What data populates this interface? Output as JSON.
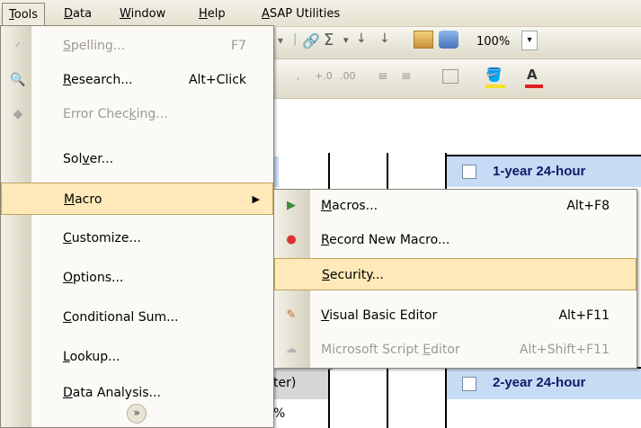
{
  "menubar": {
    "items": [
      {
        "label": "Tools",
        "mnemonic": "T",
        "rest": "ools"
      },
      {
        "label": "Data",
        "mnemonic": "D",
        "rest": "ata"
      },
      {
        "label": "Window",
        "mnemonic": "W",
        "rest": "indow"
      },
      {
        "label": "Help",
        "mnemonic": "H",
        "rest": "elp"
      },
      {
        "label": "ASAP Utilities",
        "mnemonic": "A",
        "rest": "SAP Utilities"
      }
    ]
  },
  "toolbar": {
    "zoom": "100%"
  },
  "tools_menu": {
    "items": [
      {
        "pre": "",
        "u": "S",
        "post": "pelling...",
        "shortcut": "F7",
        "icon": "spelling-icon",
        "disabled": true
      },
      {
        "pre": "",
        "u": "R",
        "post": "esearch...",
        "shortcut": "Alt+Click",
        "icon": "research-icon",
        "disabled": false
      },
      {
        "pre": "Error Chec",
        "u": "k",
        "post": "ing...",
        "shortcut": "",
        "icon": "error-checking-icon",
        "disabled": true
      },
      {
        "pre": "Sol",
        "u": "v",
        "post": "er...",
        "shortcut": "",
        "icon": "",
        "disabled": false
      },
      {
        "pre": "",
        "u": "M",
        "post": "acro",
        "shortcut": "",
        "icon": "",
        "disabled": false,
        "highlighted": true
      },
      {
        "pre": "",
        "u": "C",
        "post": "ustomize...",
        "shortcut": "",
        "icon": "",
        "disabled": false
      },
      {
        "pre": "",
        "u": "O",
        "post": "ptions...",
        "shortcut": "",
        "icon": "",
        "disabled": false
      },
      {
        "pre": "",
        "u": "C",
        "post": "onditional Sum...",
        "shortcut": "",
        "icon": "",
        "disabled": false
      },
      {
        "pre": "",
        "u": "L",
        "post": "ookup...",
        "shortcut": "",
        "icon": "",
        "disabled": false
      },
      {
        "pre": "",
        "u": "D",
        "post": "ata Analysis...",
        "shortcut": "",
        "icon": "",
        "disabled": false
      }
    ]
  },
  "macro_submenu": {
    "items": [
      {
        "pre": "",
        "u": "M",
        "post": "acros...",
        "shortcut": "Alt+F8",
        "icon": "run-macro-icon",
        "disabled": false
      },
      {
        "pre": "",
        "u": "R",
        "post": "ecord New Macro...",
        "shortcut": "",
        "icon": "record-icon",
        "disabled": false
      },
      {
        "pre": "",
        "u": "S",
        "post": "ecurity...",
        "shortcut": "",
        "icon": "",
        "disabled": false,
        "highlighted": true
      },
      {
        "pre": "",
        "u": "V",
        "post": "isual Basic Editor",
        "shortcut": "Alt+F11",
        "icon": "vb-editor-icon",
        "disabled": false
      },
      {
        "pre": "Microsoft Script ",
        "u": "E",
        "post": "ditor",
        "shortcut": "Alt+Shift+F11",
        "icon": "script-editor-icon",
        "disabled": true
      }
    ]
  },
  "sheet": {
    "cell1": "1-year 24-hour",
    "cell2": "2-year 24-hour",
    "partial1": "ter)",
    "partial2": "%"
  },
  "colors": {
    "highlight": "#ffe9b8",
    "cell_blue": "#c6dcf5"
  }
}
